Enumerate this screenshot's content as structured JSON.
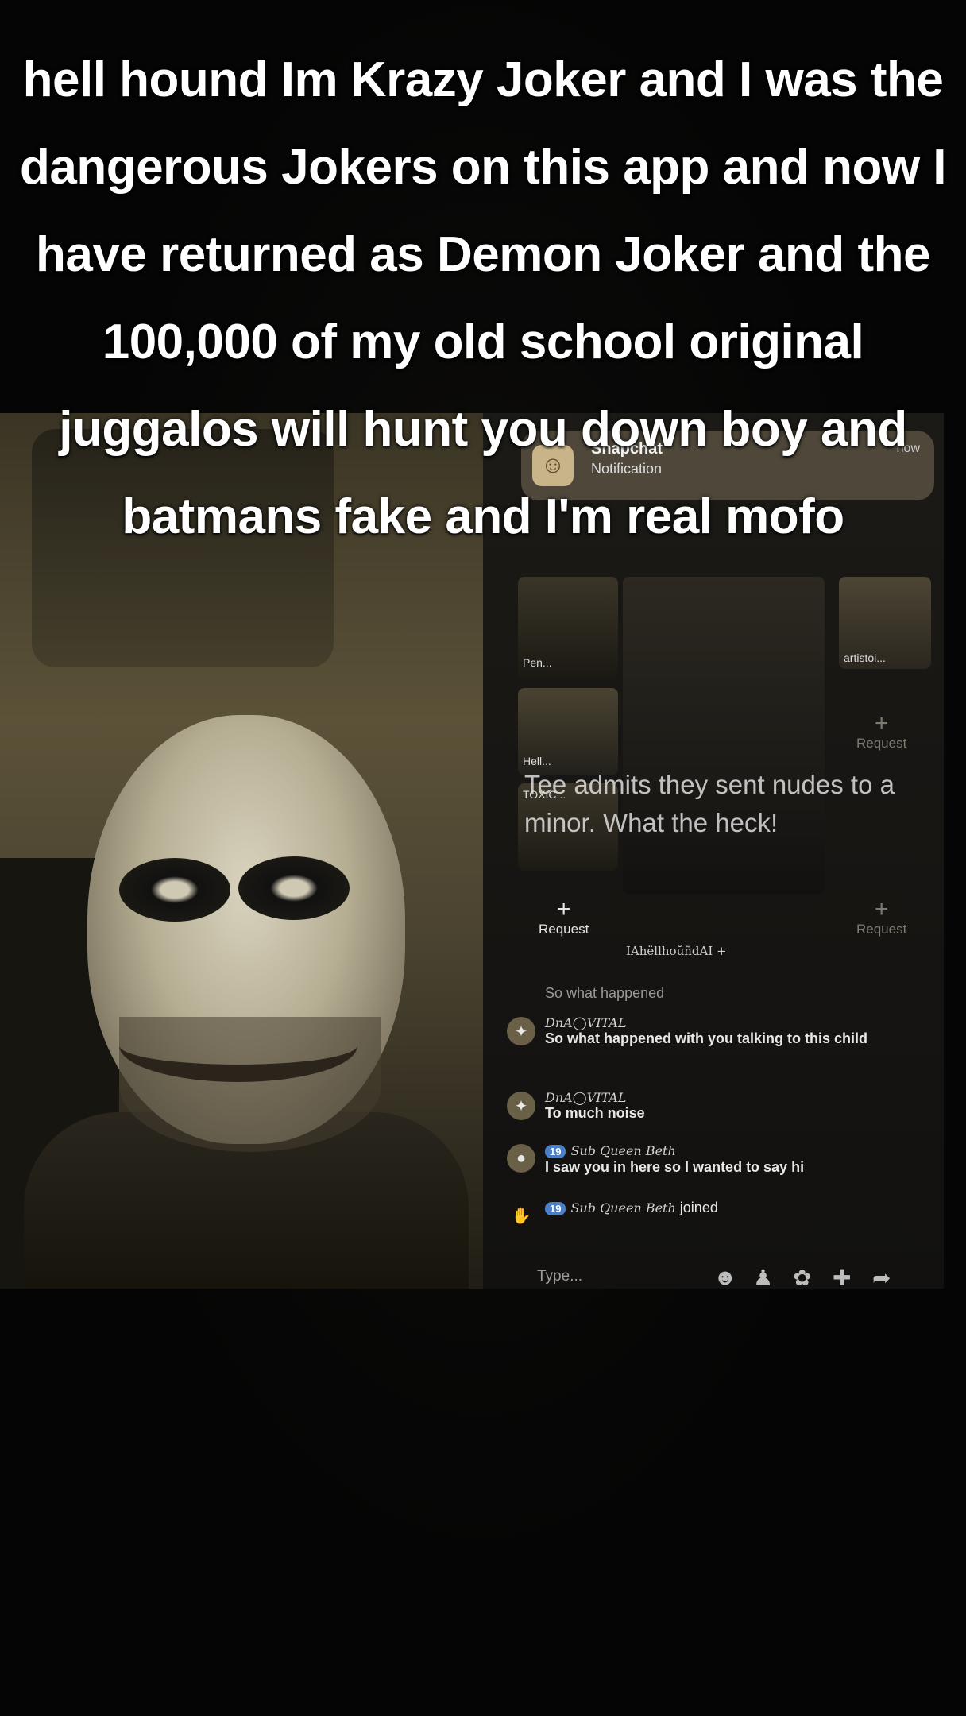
{
  "caption": {
    "text": "hell hound Im Krazy Joker and I was the dangerous Jokers on this app and now I have returned as Demon Joker and the 100,000 of my old school original juggalos will hunt you down boy and batmans fake and I'm real mofo"
  },
  "overlay_text": "Tee admits they sent nudes to a minor. What the heck!",
  "notification": {
    "app_name": "Snapchat",
    "subtitle": "Notification",
    "time": "now"
  },
  "tiles": {
    "tile_a_label": "Pen...",
    "tile_b_label": "Hell...",
    "tile_c_label": "TOXIC...",
    "tile_d_label": "artistoi..."
  },
  "requests": {
    "label": "Request",
    "plus": "+"
  },
  "host_name": "IAhëllhoŭñdAI +",
  "chat": [
    {
      "name": "",
      "text": "So what happened"
    },
    {
      "name": "DnA◯VITAL",
      "text": "So what happened with you talking to this child"
    },
    {
      "name": "DnA◯VITAL",
      "text": "To much noise"
    },
    {
      "name": "Sub Queen Beth",
      "badge": "19",
      "text": "I saw you in here so I wanted to say hi"
    },
    {
      "name": "Sub Queen Beth",
      "badge": "19",
      "text": "joined"
    }
  ],
  "input": {
    "placeholder": "Type..."
  },
  "icons": [
    "snapchat-icon",
    "emoji-icon",
    "people-icon",
    "gift-icon",
    "share-icon"
  ]
}
